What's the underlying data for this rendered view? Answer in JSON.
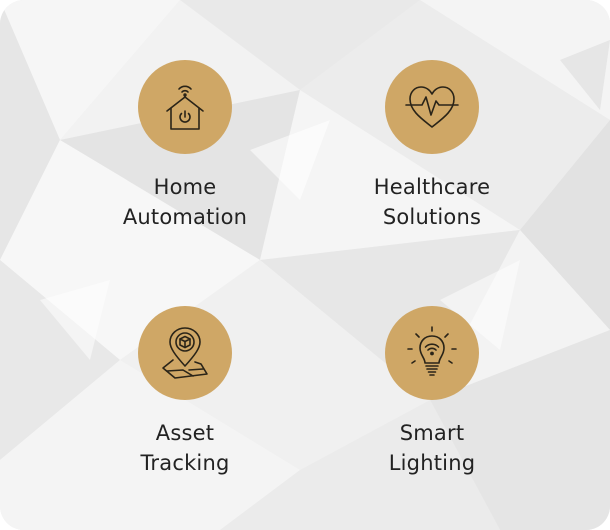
{
  "colors": {
    "accent": "#cfa766",
    "icon_stroke": "#2a2418",
    "text": "#222222",
    "background": "#f1f1f1"
  },
  "features": [
    {
      "icon": "smart-home-icon",
      "line1": "Home",
      "line2": "Automation"
    },
    {
      "icon": "heartbeat-icon",
      "line1": "Healthcare",
      "line2": "Solutions"
    },
    {
      "icon": "location-pin-package-icon",
      "line1": "Asset",
      "line2": "Tracking"
    },
    {
      "icon": "smart-bulb-icon",
      "line1": "Smart",
      "line2": "Lighting"
    }
  ]
}
